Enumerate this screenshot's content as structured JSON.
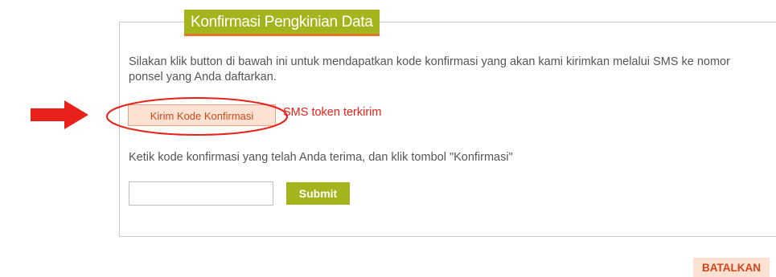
{
  "section": {
    "title": "Konfirmasi Pengkinian Data",
    "instruction": "Silakan klik button di bawah ini untuk mendapatkan kode konfirmasi yang akan kami kirimkan melalui SMS ke nomor ponsel yang Anda daftarkan.",
    "send_button_label": "Kirim Kode Konfirmasi",
    "sms_status": "SMS token terkirim",
    "confirm_instruction": "Ketik kode konfirmasi yang telah Anda terima, dan klik tombol \"Konfirmasi\"",
    "code_input_value": "",
    "code_input_placeholder": "",
    "submit_label": "Submit"
  },
  "footer": {
    "cancel_label": "BATALKAN"
  },
  "annotations": {
    "arrow_icon": "right-arrow-icon",
    "highlight_icon": "ellipse-highlight-icon",
    "color": "#e8211a"
  },
  "colors": {
    "accent_green": "#a3b41c",
    "accent_orange": "#e8732a",
    "button_peach": "#fde2d3",
    "text_gray": "#555555",
    "status_red": "#e8211a"
  }
}
